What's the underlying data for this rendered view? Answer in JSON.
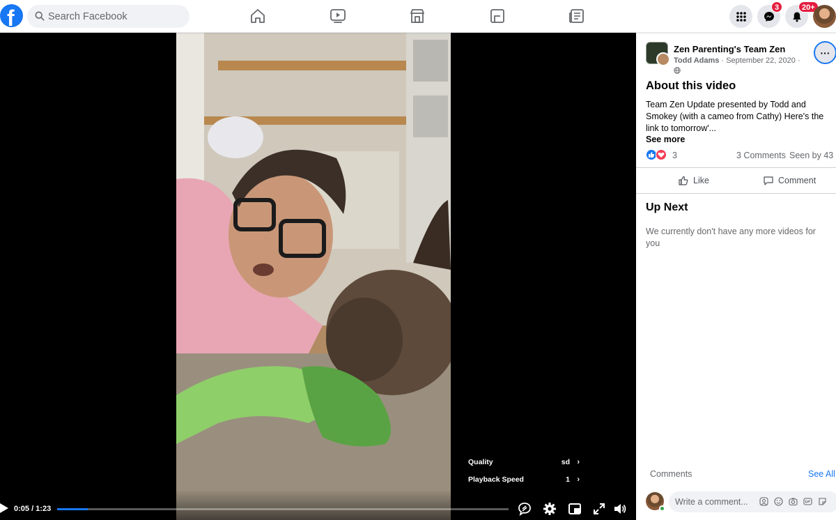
{
  "topbar": {
    "logo_letter": "f",
    "search_placeholder": "Search Facebook",
    "nav": [
      "home-icon",
      "watch-icon",
      "marketplace-icon",
      "groups-icon",
      "news-icon"
    ],
    "messenger_badge": "3",
    "notifications_badge": "20+"
  },
  "video": {
    "current_time": "0:05",
    "duration": "1:23",
    "time_display": "0:05 / 1:23",
    "progress": 0.068,
    "settings": {
      "quality_label": "Quality",
      "quality_value": "sd",
      "speed_label": "Playback Speed",
      "speed_value": "1",
      "chevron": "›"
    }
  },
  "panel": {
    "page_name": "Zen Parenting's Team Zen",
    "author": "Todd Adams",
    "separator": "·",
    "date": "September 22, 2020",
    "more_label": "···",
    "about_title": "About this video",
    "description": "Team Zen Update presented by Todd and Smokey (with a cameo from Cathy) Here's the link to tomorrow'...",
    "see_more": "See more",
    "reaction_count": "3",
    "comments_count": "3 Comments",
    "seen_by": "Seen by 43",
    "like_label": "Like",
    "comment_label": "Comment",
    "up_next_title": "Up Next",
    "no_videos_text": "We currently don't have any more videos for you",
    "comments_label": "Comments",
    "see_all": "See All",
    "comment_placeholder": "Write a comment..."
  },
  "colors": {
    "brand": "#1877f2",
    "badge": "#e41e3f",
    "secondary_text": "#65676b"
  }
}
